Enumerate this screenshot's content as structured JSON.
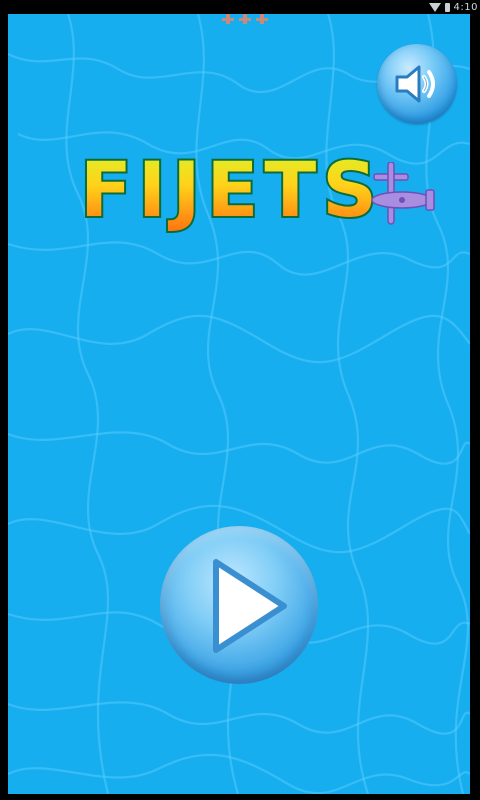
{
  "status_bar": {
    "time": "4:10",
    "icons": [
      "wifi-icon",
      "battery-icon"
    ]
  },
  "game": {
    "title": "FIJETS",
    "background_color": "#17aef0",
    "title_gradient_top": "#c9f230",
    "title_gradient_bottom": "#ff7a10",
    "sound_button_icon": "speaker-icon",
    "play_button_icon": "play-icon"
  }
}
